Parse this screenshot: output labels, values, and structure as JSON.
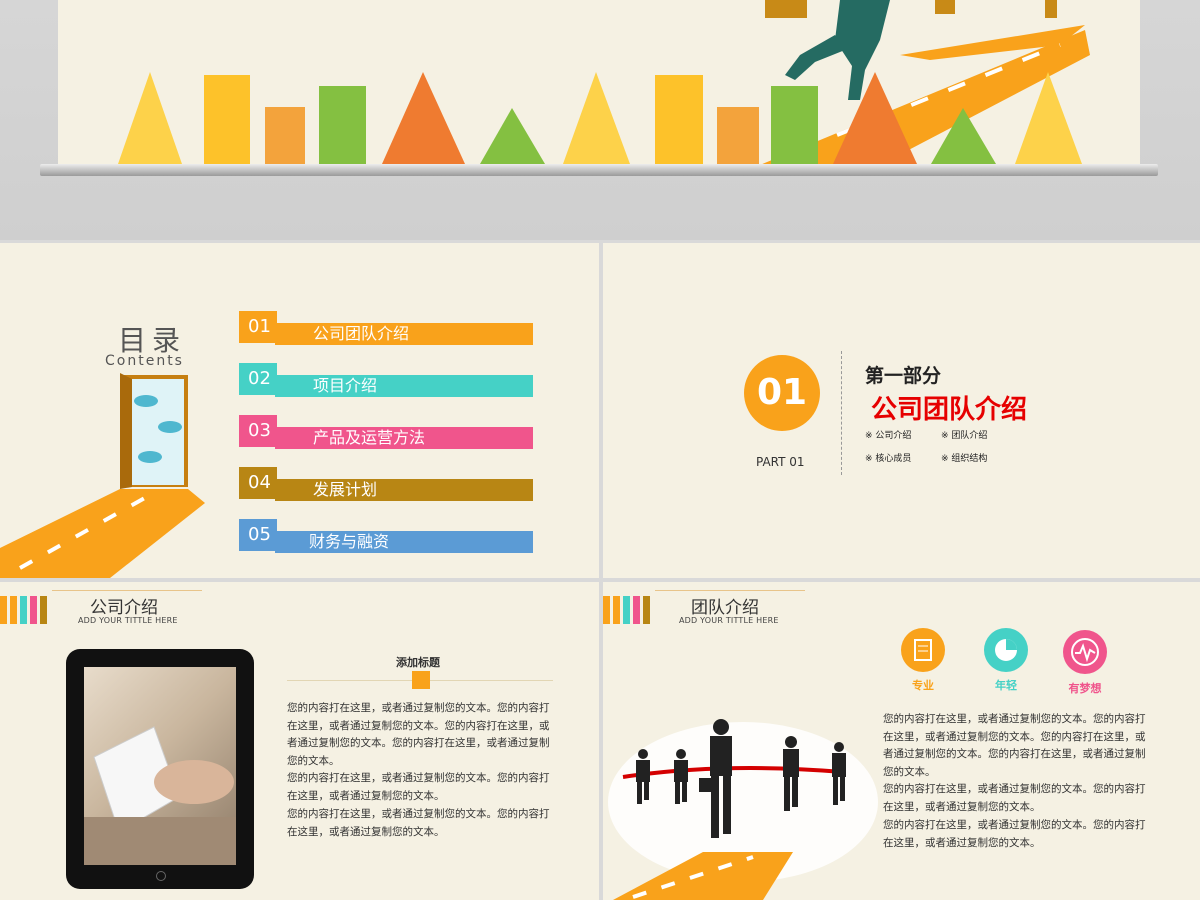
{
  "toc": {
    "title": "目录",
    "subtitle": "Contents",
    "items": [
      {
        "num": "01",
        "label": "公司团队介绍",
        "color": "#f9a21b"
      },
      {
        "num": "02",
        "label": "项目介绍",
        "color": "#45d1c6"
      },
      {
        "num": "03",
        "label": "产品及运营方法",
        "color": "#f0558c"
      },
      {
        "num": "04",
        "label": "发展计划",
        "color": "#b88614"
      },
      {
        "num": "05",
        "label": "财务与融资",
        "color": "#5b9bd5"
      }
    ]
  },
  "section": {
    "number": "01",
    "part": "PART 01",
    "heading": "第一部分",
    "title": "公司团队介绍",
    "bullets": [
      "※ 公司介绍",
      "※ 团队介绍",
      "※ 核心成员",
      "※ 组织结构"
    ]
  },
  "company": {
    "title": "公司介绍",
    "subtitle": "ADD YOUR TITTLE HERE",
    "add_title": "添加标题",
    "paragraphs": [
      "您的内容打在这里，或者通过复制您的文本。您的内容打在这里，或者通过复制您的文本。您的内容打在这里，或者通过复制您的文本。您的内容打在这里，或者通过复制您的文本。",
      "您的内容打在这里，或者通过复制您的文本。您的内容打在这里，或者通过复制您的文本。",
      "您的内容打在这里，或者通过复制您的文本。您的内容打在这里，或者通过复制您的文本。"
    ]
  },
  "team": {
    "title": "团队介绍",
    "subtitle": "ADD YOUR TITTLE HERE",
    "features": [
      {
        "label": "专业",
        "color": "#f9a21b",
        "icon": "document-icon"
      },
      {
        "label": "年轻",
        "color": "#45d1c6",
        "icon": "pie-chart-icon"
      },
      {
        "label": "有梦想",
        "color": "#f0558c",
        "icon": "heartbeat-icon"
      }
    ],
    "paragraphs": [
      "您的内容打在这里，或者通过复制您的文本。您的内容打在这里，或者通过复制您的文本。您的内容打在这里，或者通过复制您的文本。您的内容打在这里，或者通过复制您的文本。",
      "您的内容打在这里，或者通过复制您的文本。您的内容打在这里，或者通过复制您的文本。",
      "您的内容打在这里，或者通过复制您的文本。您的内容打在这里，或者通过复制您的文本。"
    ]
  }
}
